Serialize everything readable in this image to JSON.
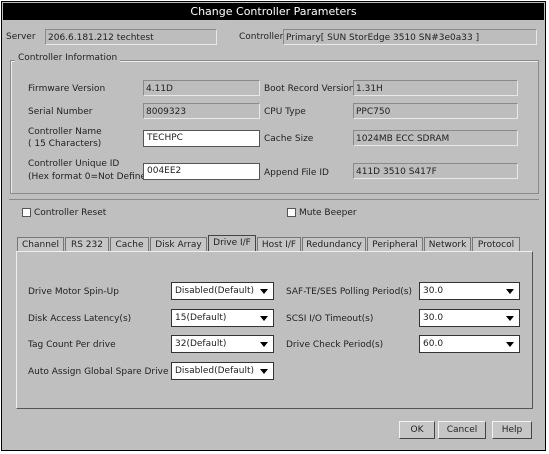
{
  "window": {
    "title": "Change Controller Parameters"
  },
  "server": {
    "label": "Server",
    "value": "206.6.181.212 techtest"
  },
  "controller": {
    "label": "Controller",
    "value": "Primary[ SUN StorEdge 3510 SN#3e0a33 ]"
  },
  "controller_info": {
    "group_label": "Controller Information",
    "firmware_version": {
      "label": "Firmware Version",
      "value": "4.11D"
    },
    "boot_record_version": {
      "label": "Boot Record Version",
      "value": "1.31H"
    },
    "serial_number": {
      "label": "Serial Number",
      "value": "8009323"
    },
    "cpu_type": {
      "label": "CPU Type",
      "value": "PPC750"
    },
    "controller_name": {
      "label1": "Controller Name",
      "label2": "( 15 Characters)",
      "value": "TECHPC"
    },
    "cache_size": {
      "label": "Cache Size",
      "value": "1024MB ECC SDRAM"
    },
    "controller_unique_id": {
      "label1": "Controller Unique ID",
      "label2": "(Hex format 0=Not Defined)",
      "value": "004EE2"
    },
    "append_file_id": {
      "label": "Append File ID",
      "value": "411D 3510 S417F"
    }
  },
  "options": {
    "controller_reset": "Controller Reset",
    "mute_beeper": "Mute Beeper"
  },
  "tabs": [
    {
      "label": "Channel"
    },
    {
      "label": "RS 232"
    },
    {
      "label": "Cache"
    },
    {
      "label": "Disk Array"
    },
    {
      "label": "Drive I/F"
    },
    {
      "label": "Host I/F"
    },
    {
      "label": "Redundancy"
    },
    {
      "label": "Peripheral"
    },
    {
      "label": "Network"
    },
    {
      "label": "Protocol"
    }
  ],
  "active_tab": "Drive I/F",
  "drive_if": {
    "drive_motor_spin_up": {
      "label": "Drive Motor Spin-Up",
      "value": "Disabled(Default)"
    },
    "disk_access_latency": {
      "label": "Disk Access Latency(s)",
      "value": "15(Default)"
    },
    "tag_count_per_drive": {
      "label": "Tag Count Per drive",
      "value": "32(Default)"
    },
    "auto_assign_global_spare": {
      "label": "Auto Assign Global Spare Drive",
      "value": "Disabled(Default)"
    },
    "saf_te_ses_polling_period": {
      "label": "SAF-TE/SES Polling Period(s)",
      "value": "30.0"
    },
    "scsi_io_timeout": {
      "label": "SCSI I/O Timeout(s)",
      "value": "30.0"
    },
    "drive_check_period": {
      "label": "Drive Check Period(s)",
      "value": "60.0"
    }
  },
  "buttons": {
    "ok": "OK",
    "cancel": "Cancel",
    "help": "Help"
  }
}
